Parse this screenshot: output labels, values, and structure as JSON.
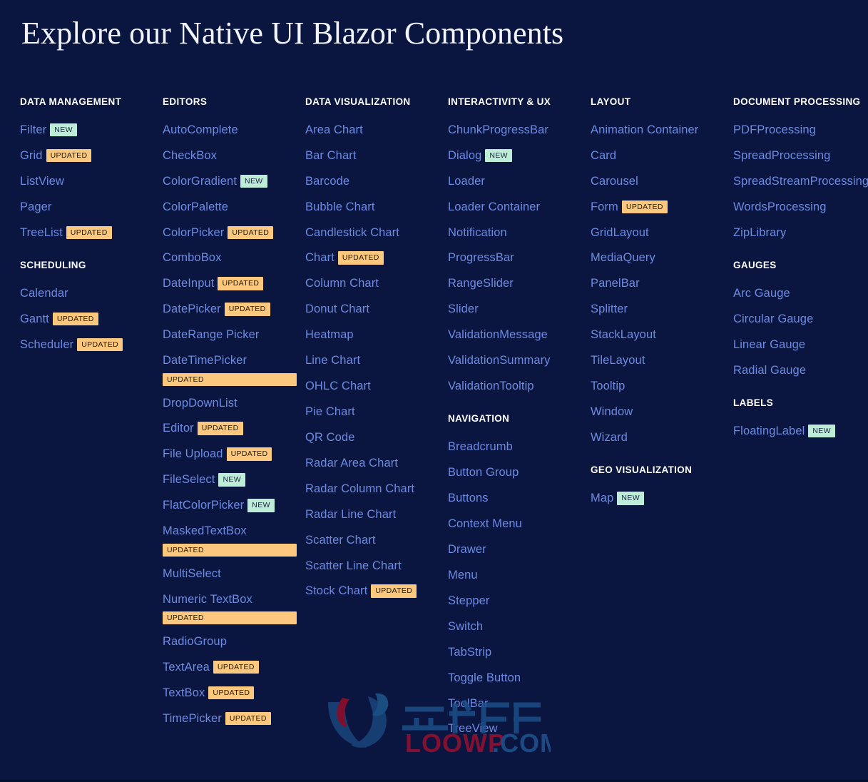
{
  "page": {
    "title": "Explore our Native UI Blazor Components",
    "background_color": "#0a1640",
    "link_color": "#6d8be2",
    "heading_color": "#ffffff",
    "badge_new_color": "#bdecd7",
    "badge_updated_color": "#fbc87e"
  },
  "badges": {
    "new": "NEW",
    "updated": "UPDATED"
  },
  "watermark": {
    "text_cn": "云创源码",
    "text_en": "LOOWP",
    "text_tld": ".COM"
  },
  "columns": [
    {
      "groups": [
        {
          "title": "DATA MANAGEMENT",
          "items": [
            {
              "label": "Filter",
              "badge": "NEW",
              "badge_type": "new"
            },
            {
              "label": "Grid",
              "badge": "UPDATED",
              "badge_type": "updated"
            },
            {
              "label": "ListView",
              "badge": null
            },
            {
              "label": "Pager",
              "badge": null
            },
            {
              "label": "TreeList",
              "badge": "UPDATED",
              "badge_type": "updated"
            }
          ]
        },
        {
          "title": "SCHEDULING",
          "items": [
            {
              "label": "Calendar",
              "badge": null
            },
            {
              "label": "Gantt",
              "badge": "UPDATED",
              "badge_type": "updated"
            },
            {
              "label": "Scheduler",
              "badge": "UPDATED",
              "badge_type": "updated"
            }
          ]
        }
      ]
    },
    {
      "groups": [
        {
          "title": "EDITORS",
          "items": [
            {
              "label": "AutoComplete",
              "badge": null
            },
            {
              "label": "CheckBox",
              "badge": null
            },
            {
              "label": "ColorGradient",
              "badge": "NEW",
              "badge_type": "new"
            },
            {
              "label": "ColorPalette",
              "badge": null
            },
            {
              "label": "ColorPicker",
              "badge": "UPDATED",
              "badge_type": "updated"
            },
            {
              "label": "ComboBox",
              "badge": null
            },
            {
              "label": "DateInput",
              "badge": "UPDATED",
              "badge_type": "updated"
            },
            {
              "label": "DatePicker",
              "badge": "UPDATED",
              "badge_type": "updated"
            },
            {
              "label": "DateRange Picker",
              "badge": null
            },
            {
              "label": "DateTimePicker",
              "badge": "UPDATED",
              "badge_type": "updated",
              "badge_on_new_line": true
            },
            {
              "label": "DropDownList",
              "badge": null
            },
            {
              "label": "Editor",
              "badge": "UPDATED",
              "badge_type": "updated"
            },
            {
              "label": "File Upload",
              "badge": "UPDATED",
              "badge_type": "updated"
            },
            {
              "label": "FileSelect",
              "badge": "NEW",
              "badge_type": "new"
            },
            {
              "label": "FlatColorPicker",
              "badge": "NEW",
              "badge_type": "new"
            },
            {
              "label": "MaskedTextBox",
              "badge": "UPDATED",
              "badge_type": "updated",
              "badge_on_new_line": true
            },
            {
              "label": "MultiSelect",
              "badge": null
            },
            {
              "label": "Numeric TextBox",
              "badge": "UPDATED",
              "badge_type": "updated",
              "badge_on_new_line": true
            },
            {
              "label": "RadioGroup",
              "badge": null
            },
            {
              "label": "TextArea",
              "badge": "UPDATED",
              "badge_type": "updated"
            },
            {
              "label": "TextBox",
              "badge": "UPDATED",
              "badge_type": "updated"
            },
            {
              "label": "TimePicker",
              "badge": "UPDATED",
              "badge_type": "updated"
            }
          ]
        }
      ]
    },
    {
      "groups": [
        {
          "title": "DATA VISUALIZATION",
          "items": [
            {
              "label": "Area Chart",
              "badge": null
            },
            {
              "label": "Bar Chart",
              "badge": null
            },
            {
              "label": "Barcode",
              "badge": null
            },
            {
              "label": "Bubble Chart",
              "badge": null
            },
            {
              "label": "Candlestick Chart",
              "badge": null
            },
            {
              "label": "Chart",
              "badge": "UPDATED",
              "badge_type": "updated"
            },
            {
              "label": "Column Chart",
              "badge": null
            },
            {
              "label": "Donut Chart",
              "badge": null
            },
            {
              "label": "Heatmap",
              "badge": null
            },
            {
              "label": "Line Chart",
              "badge": null
            },
            {
              "label": "OHLC Chart",
              "badge": null
            },
            {
              "label": "Pie Chart",
              "badge": null
            },
            {
              "label": "QR Code",
              "badge": null
            },
            {
              "label": "Radar Area Chart",
              "badge": null
            },
            {
              "label": "Radar Column Chart",
              "badge": null
            },
            {
              "label": "Radar Line Chart",
              "badge": null
            },
            {
              "label": "Scatter Chart",
              "badge": null
            },
            {
              "label": "Scatter Line Chart",
              "badge": null
            },
            {
              "label": "Stock Chart",
              "badge": "UPDATED",
              "badge_type": "updated"
            }
          ]
        }
      ]
    },
    {
      "groups": [
        {
          "title": "INTERACTIVITY & UX",
          "items": [
            {
              "label": "ChunkProgressBar",
              "badge": null
            },
            {
              "label": "Dialog",
              "badge": "NEW",
              "badge_type": "new"
            },
            {
              "label": "Loader",
              "badge": null
            },
            {
              "label": "Loader Container",
              "badge": null
            },
            {
              "label": "Notification",
              "badge": null
            },
            {
              "label": "ProgressBar",
              "badge": null
            },
            {
              "label": "RangeSlider",
              "badge": null
            },
            {
              "label": "Slider",
              "badge": null
            },
            {
              "label": "ValidationMessage",
              "badge": null
            },
            {
              "label": "ValidationSummary",
              "badge": null
            },
            {
              "label": "ValidationTooltip",
              "badge": null
            }
          ]
        },
        {
          "title": "NAVIGATION",
          "items": [
            {
              "label": "Breadcrumb",
              "badge": null
            },
            {
              "label": "Button Group",
              "badge": null
            },
            {
              "label": "Buttons",
              "badge": null
            },
            {
              "label": "Context Menu",
              "badge": null
            },
            {
              "label": "Drawer",
              "badge": null
            },
            {
              "label": "Menu",
              "badge": null
            },
            {
              "label": "Stepper",
              "badge": null
            },
            {
              "label": "Switch",
              "badge": null
            },
            {
              "label": "TabStrip",
              "badge": null
            },
            {
              "label": "Toggle Button",
              "badge": null
            },
            {
              "label": "ToolBar",
              "badge": null
            },
            {
              "label": "TreeView",
              "badge": null
            }
          ]
        }
      ]
    },
    {
      "groups": [
        {
          "title": "LAYOUT",
          "items": [
            {
              "label": "Animation Container",
              "badge": null
            },
            {
              "label": "Card",
              "badge": null
            },
            {
              "label": "Carousel",
              "badge": null
            },
            {
              "label": "Form",
              "badge": "UPDATED",
              "badge_type": "updated"
            },
            {
              "label": "GridLayout",
              "badge": null
            },
            {
              "label": "MediaQuery",
              "badge": null
            },
            {
              "label": "PanelBar",
              "badge": null
            },
            {
              "label": "Splitter",
              "badge": null
            },
            {
              "label": "StackLayout",
              "badge": null
            },
            {
              "label": "TileLayout",
              "badge": null
            },
            {
              "label": "Tooltip",
              "badge": null
            },
            {
              "label": "Window",
              "badge": null
            },
            {
              "label": "Wizard",
              "badge": null
            }
          ]
        },
        {
          "title": "GEO VISUALIZATION",
          "items": [
            {
              "label": "Map",
              "badge": "NEW",
              "badge_type": "new"
            }
          ]
        }
      ]
    },
    {
      "groups": [
        {
          "title": "DOCUMENT PROCESSING",
          "items": [
            {
              "label": "PDFProcessing",
              "badge": null
            },
            {
              "label": "SpreadProcessing",
              "badge": null
            },
            {
              "label": "SpreadStreamProcessing",
              "badge": null
            },
            {
              "label": "WordsProcessing",
              "badge": null
            },
            {
              "label": "ZipLibrary",
              "badge": null
            }
          ]
        },
        {
          "title": "GAUGES",
          "items": [
            {
              "label": "Arc Gauge",
              "badge": null
            },
            {
              "label": "Circular Gauge",
              "badge": null
            },
            {
              "label": "Linear Gauge",
              "badge": null
            },
            {
              "label": "Radial Gauge",
              "badge": null
            }
          ]
        },
        {
          "title": "LABELS",
          "items": [
            {
              "label": "FloatingLabel",
              "badge": "NEW",
              "badge_type": "new"
            }
          ]
        }
      ]
    }
  ]
}
